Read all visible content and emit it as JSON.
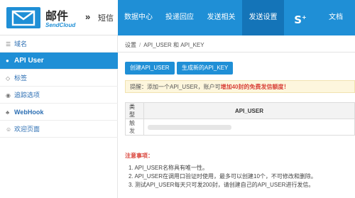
{
  "brand": {
    "title": "邮件",
    "subtitle": "SendCloud",
    "arrow": "»",
    "section": "短信"
  },
  "nav": [
    {
      "label": "数据中心",
      "active": false
    },
    {
      "label": "投递回应",
      "active": false
    },
    {
      "label": "发送相关",
      "active": false
    },
    {
      "label": "发送设置",
      "active": true
    },
    {
      "label": "S",
      "active": false
    },
    {
      "label": "文档",
      "active": false
    }
  ],
  "sidebar": {
    "items": [
      {
        "label": "域名",
        "icon": "globe-icon"
      },
      {
        "label": "API User",
        "icon": "user-icon"
      },
      {
        "label": "标签",
        "icon": "tag-icon"
      },
      {
        "label": "追踪选项",
        "icon": "eye-icon"
      },
      {
        "label": "WebHook",
        "icon": "webhook-icon"
      },
      {
        "label": "欢迎页面",
        "icon": "smile-icon"
      }
    ]
  },
  "breadcrumb": {
    "root": "设置",
    "separator": "/",
    "current": "API_USER 和 API_KEY"
  },
  "buttons": {
    "create": "创建API_USER",
    "generate": "生成新的API_KEY"
  },
  "alert": {
    "prefix": "提醒：添加一个API_USER，账户可",
    "highlight": "增加40封的免费发信额度！"
  },
  "table": {
    "headers": [
      "类型",
      "API_USER"
    ],
    "rows": [
      {
        "type": "触发"
      }
    ]
  },
  "notes": {
    "title": "注意事项：",
    "items": [
      "1. API_USER名称具有唯一性。",
      "2. API_USER在调用口验证时使用，最多可以创建10个，不可修改和删除。",
      "3. 测试API_USER每天只可发200封，请创建自己的API_USER进行发信。"
    ]
  },
  "colors": {
    "primary": "#1f8fd6",
    "nav_active": "#1474b8",
    "highlight": "#d9443b"
  }
}
